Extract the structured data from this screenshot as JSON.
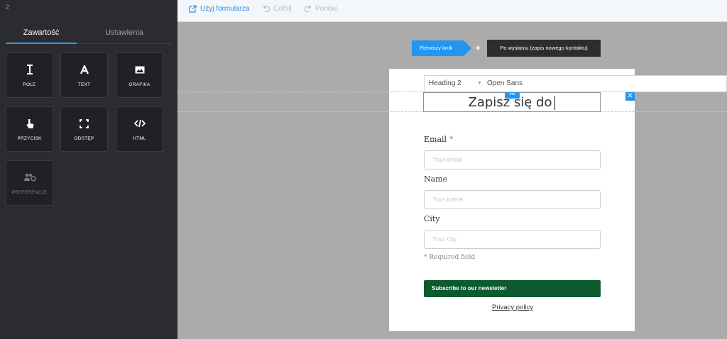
{
  "sidebar": {
    "number": "2",
    "tabs": [
      {
        "label": "Zawartość",
        "active": true
      },
      {
        "label": "Ustawienia",
        "active": false
      }
    ],
    "tiles": [
      {
        "label": "POLE",
        "icon": "text-cursor-icon"
      },
      {
        "label": "TEXT",
        "icon": "letter-a-icon"
      },
      {
        "label": "GRAFIKA",
        "icon": "image-icon"
      },
      {
        "label": "PRZYCISK",
        "icon": "pointer-hand-icon"
      },
      {
        "label": "ODSTĘP",
        "icon": "expand-icon"
      },
      {
        "label": "HTML",
        "icon": "code-icon"
      },
      {
        "label": "PREFERENCJE",
        "icon": "users-gear-icon"
      }
    ]
  },
  "toolbar": {
    "use_form": "Użyj formularza",
    "undo": "Cofnij",
    "redo": "Ponów"
  },
  "steps": {
    "first": "Pierwszy krok",
    "second": "Po wysłaniu (zapis nowego kontaktu)"
  },
  "format_toolbar": {
    "block_style": "Heading 2",
    "font": "Open Sans"
  },
  "form": {
    "heading": "Zapisz się do",
    "fields": [
      {
        "label": "Email",
        "required": "*",
        "placeholder": "Your email"
      },
      {
        "label": "Name",
        "placeholder": "Your name"
      },
      {
        "label": "City",
        "placeholder": "Your city"
      }
    ],
    "required_hint": "* Required field",
    "submit_label": "Subscribe to our newsletter",
    "privacy_label": "Privacy policy"
  },
  "colors": {
    "accent": "#2196f3",
    "sidebar_bg": "#2a2c2f",
    "submit_bg": "#0d5a2e",
    "canvas_bg": "#ababab"
  }
}
